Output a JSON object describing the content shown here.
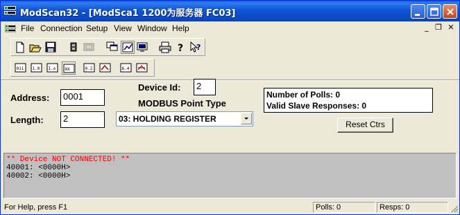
{
  "window": {
    "title": "ModScan32 - [ModSca1 1200为服务器 FC03]",
    "icon": "modscan-app-icon"
  },
  "menu": {
    "items": [
      "File",
      "Connection",
      "Setup",
      "View",
      "Window",
      "Help"
    ],
    "mdi_controls": [
      "minimize-icon",
      "restore-icon",
      "close-icon"
    ]
  },
  "toolbar1": {
    "buttons": [
      "new-file-icon",
      "open-folder-icon",
      "save-icon",
      "connect-icon",
      "disconnect-icon",
      "tile-windows-icon",
      "graph-icon",
      "display-icon",
      "print-icon",
      "help-icon",
      "context-help-icon"
    ]
  },
  "toolbar2": {
    "buttons": [
      "coil-status-icon",
      "input-status-icon",
      "input-register-icon",
      "holding-register-icon",
      "write-coil-icon",
      "write-register-icon",
      "force-coils-icon",
      "preset-registers-icon"
    ]
  },
  "form": {
    "address_label": "Address:",
    "address_value": "0001",
    "length_label": "Length:",
    "length_value": "2",
    "device_id_label": "Device Id:",
    "device_id_value": "2",
    "point_type_label": "MODBUS Point Type",
    "point_type_value": "03: HOLDING REGISTER"
  },
  "stats": {
    "polls_text": "Number of Polls: 0",
    "responses_text": "Valid Slave Responses: 0"
  },
  "reset_button_label": "Reset Ctrs",
  "data_area": {
    "error_text": "** Device NOT CONNECTED! **",
    "registers": [
      "40001: <0000H>",
      "40002: <0000H>"
    ]
  },
  "statusbar": {
    "help": "For Help, press F1",
    "polls": "Polls: 0",
    "resps": "Resps: 0"
  },
  "colors": {
    "title_bar": "#0A49C4",
    "error_text": "#FF0000",
    "data_background": "#C0C0C0",
    "chrome": "#ECE9D8"
  }
}
